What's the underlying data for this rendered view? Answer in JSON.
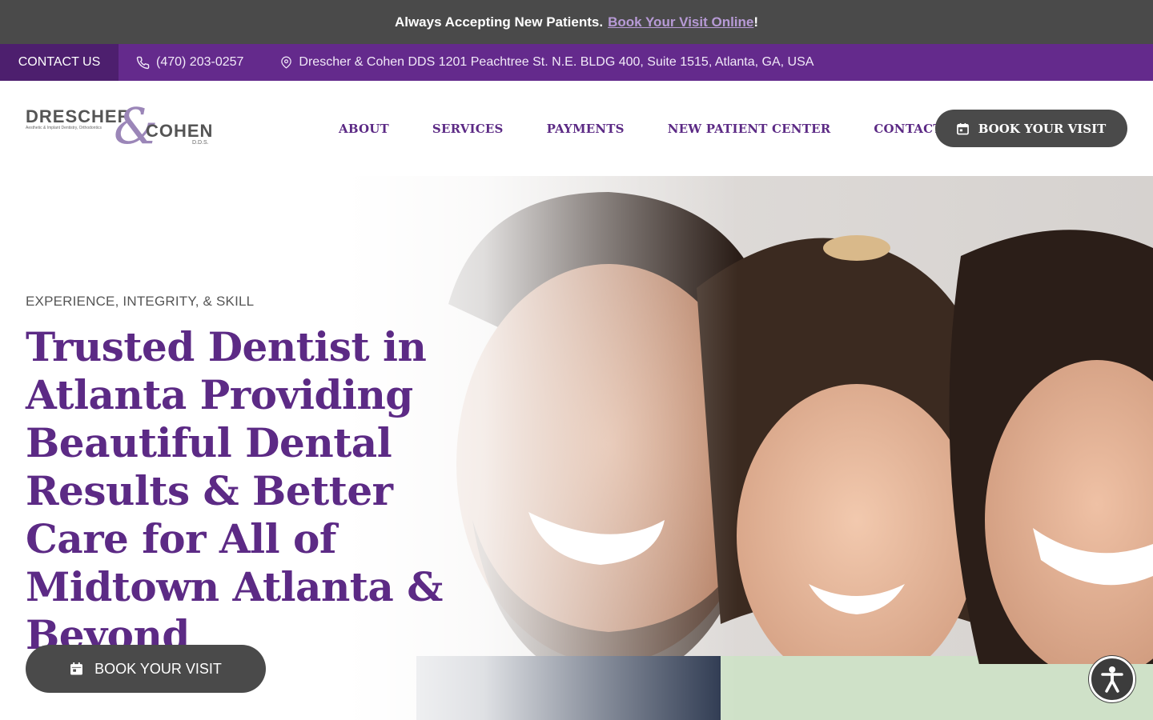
{
  "announcement": {
    "text": "Always Accepting New Patients.",
    "link": "Book Your Visit Online",
    "suffix": "!"
  },
  "contact_bar": {
    "contact_label": "CONTACT US",
    "phone": "(470) 203-0257",
    "phone_icon": "phone-icon",
    "address": "Drescher & Cohen DDS 1201 Peachtree St. N.E. BLDG 400, Suite 1515, Atlanta, GA, USA",
    "address_icon": "map-pin-icon"
  },
  "logo": {
    "word1": "DRESCHER",
    "amp": "&",
    "word2": "COHEN",
    "tagline": "Aesthetic & Implant Dentistry, Orthodontics",
    "suffix": "D.D.S."
  },
  "nav": {
    "items": [
      "ABOUT",
      "SERVICES",
      "PAYMENTS",
      "NEW PATIENT CENTER",
      "CONTACT"
    ],
    "book_label": "BOOK YOUR VISIT"
  },
  "hero": {
    "eyebrow": "EXPERIENCE, INTEGRITY, & SKILL",
    "headline": "Trusted Dentist in Atlanta Providing Beautiful Dental Results & Better Care for All of Midtown Atlanta & Beyond",
    "book_label": "BOOK YOUR VISIT",
    "calendar_icon": "calendar-icon"
  },
  "accessibility": {
    "icon": "accessibility-icon"
  },
  "colors": {
    "brand_purple": "#5c2a85",
    "bar_purple": "#642a8c",
    "dark_gray": "#4a4a4a"
  }
}
